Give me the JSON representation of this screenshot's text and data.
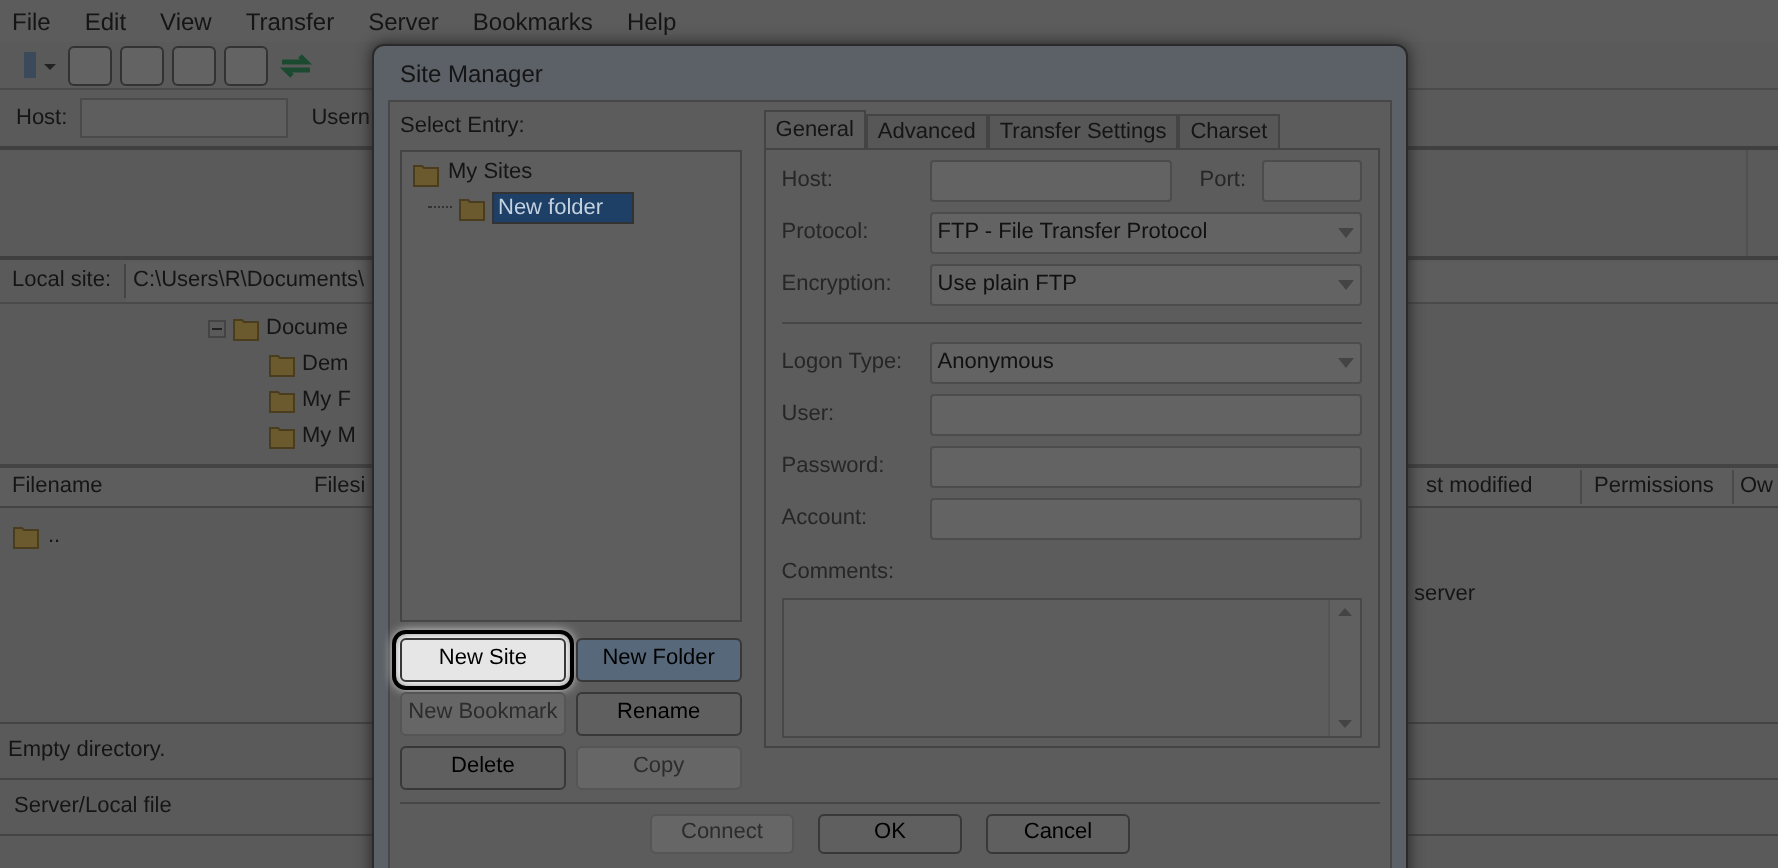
{
  "menu": [
    "File",
    "Edit",
    "View",
    "Transfer",
    "Server",
    "Bookmarks",
    "Help"
  ],
  "quickconnect": {
    "host_label": "Host:",
    "user_label": "Usern"
  },
  "local_site": {
    "label": "Local site:",
    "path": "C:\\Users\\R\\Documents\\"
  },
  "local_tree": [
    {
      "label": "Docume",
      "expanded": true,
      "children": [
        {
          "label": "Dem"
        },
        {
          "label": "My F"
        },
        {
          "label": "My M"
        }
      ]
    }
  ],
  "file_list": {
    "columns": [
      "Filename",
      "Filesi"
    ],
    "right_columns": [
      "st modified",
      "Permissions",
      "Ow"
    ],
    "rows": [
      ".."
    ],
    "right_text": "server"
  },
  "status": "Empty directory.",
  "queue_column": "Server/Local file",
  "dialog": {
    "title": "Site Manager",
    "select_entry_label": "Select Entry:",
    "tree": [
      {
        "label": "My Sites",
        "children": [
          {
            "label": "New folder",
            "editing": true
          }
        ]
      }
    ],
    "buttons": [
      {
        "label": "New Site",
        "disabled": false,
        "focused": true,
        "hovered": false
      },
      {
        "label": "New Folder",
        "disabled": false,
        "focused": false,
        "hovered": true
      },
      {
        "label": "New Bookmark",
        "disabled": true,
        "focused": false,
        "hovered": false
      },
      {
        "label": "Rename",
        "disabled": false,
        "focused": false,
        "hovered": false
      },
      {
        "label": "Delete",
        "disabled": false,
        "focused": false,
        "hovered": false
      },
      {
        "label": "Copy",
        "disabled": true,
        "focused": false,
        "hovered": false
      }
    ],
    "tabs": [
      {
        "label": "General",
        "selected": true
      },
      {
        "label": "Advanced",
        "selected": false
      },
      {
        "label": "Transfer Settings",
        "selected": false
      },
      {
        "label": "Charset",
        "selected": false
      }
    ],
    "fields": [
      {
        "kind": "host",
        "label": "Host:",
        "port_label": "Port:"
      },
      {
        "kind": "select",
        "label": "Protocol:",
        "value": "FTP - File Transfer Protocol"
      },
      {
        "kind": "select",
        "label": "Encryption:",
        "value": "Use plain FTP"
      },
      {
        "kind": "separator"
      },
      {
        "kind": "select",
        "label": "Logon Type:",
        "value": "Anonymous"
      },
      {
        "kind": "text",
        "label": "User:"
      },
      {
        "kind": "text",
        "label": "Password:"
      },
      {
        "kind": "text",
        "label": "Account:"
      },
      {
        "kind": "textarea",
        "label": "Comments:"
      }
    ],
    "bottom_buttons": [
      {
        "label": "Connect",
        "disabled": true
      },
      {
        "label": "OK",
        "disabled": false
      },
      {
        "label": "Cancel",
        "disabled": false
      }
    ]
  }
}
